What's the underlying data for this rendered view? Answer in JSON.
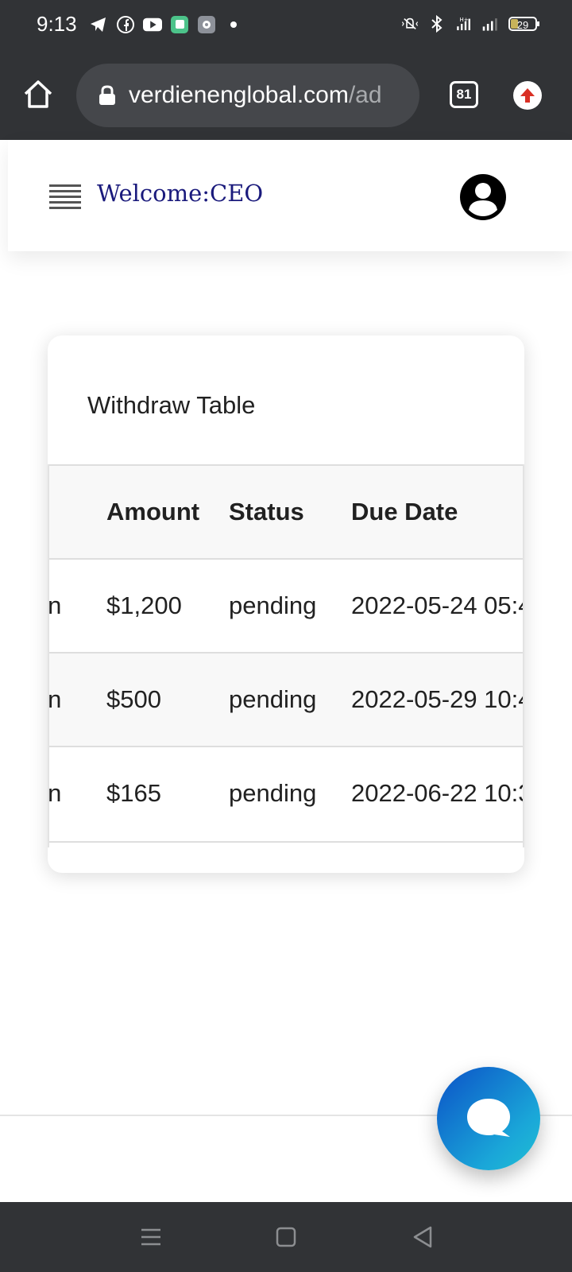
{
  "status_bar": {
    "time": "9:13",
    "battery": "29",
    "notification_icons": [
      "telegram-icon",
      "facebook-icon",
      "youtube-icon",
      "app-icon",
      "settings-app-icon",
      "dot-icon"
    ],
    "system_icons": [
      "vibrate-icon",
      "bluetooth-icon",
      "signal-hplus-icon",
      "signal-icon",
      "battery-icon"
    ]
  },
  "browser": {
    "url_domain": "verdienenglobal.com",
    "url_path": "/ad",
    "tab_count": "81"
  },
  "header": {
    "welcome": "Welcome:CEO"
  },
  "card": {
    "title": "Withdraw Table",
    "columns": [
      "",
      "Amount",
      "Status",
      "Due Date"
    ],
    "rows": [
      {
        "method": "oin",
        "amount": "$1,200",
        "status": "pending",
        "due_date": "2022-05-24 05:4"
      },
      {
        "method": "oin",
        "amount": "$500",
        "status": "pending",
        "due_date": "2022-05-29 10:4"
      },
      {
        "method": "oin",
        "amount": "$165",
        "status": "pending",
        "due_date": "2022-06-22 10:3"
      }
    ]
  },
  "colors": {
    "chrome": "#313336",
    "welcome_text": "#1a1a7c",
    "chat_gradient_start": "#0b51c7",
    "chat_gradient_end": "#20c0d4",
    "update_arrow": "#d93025"
  }
}
